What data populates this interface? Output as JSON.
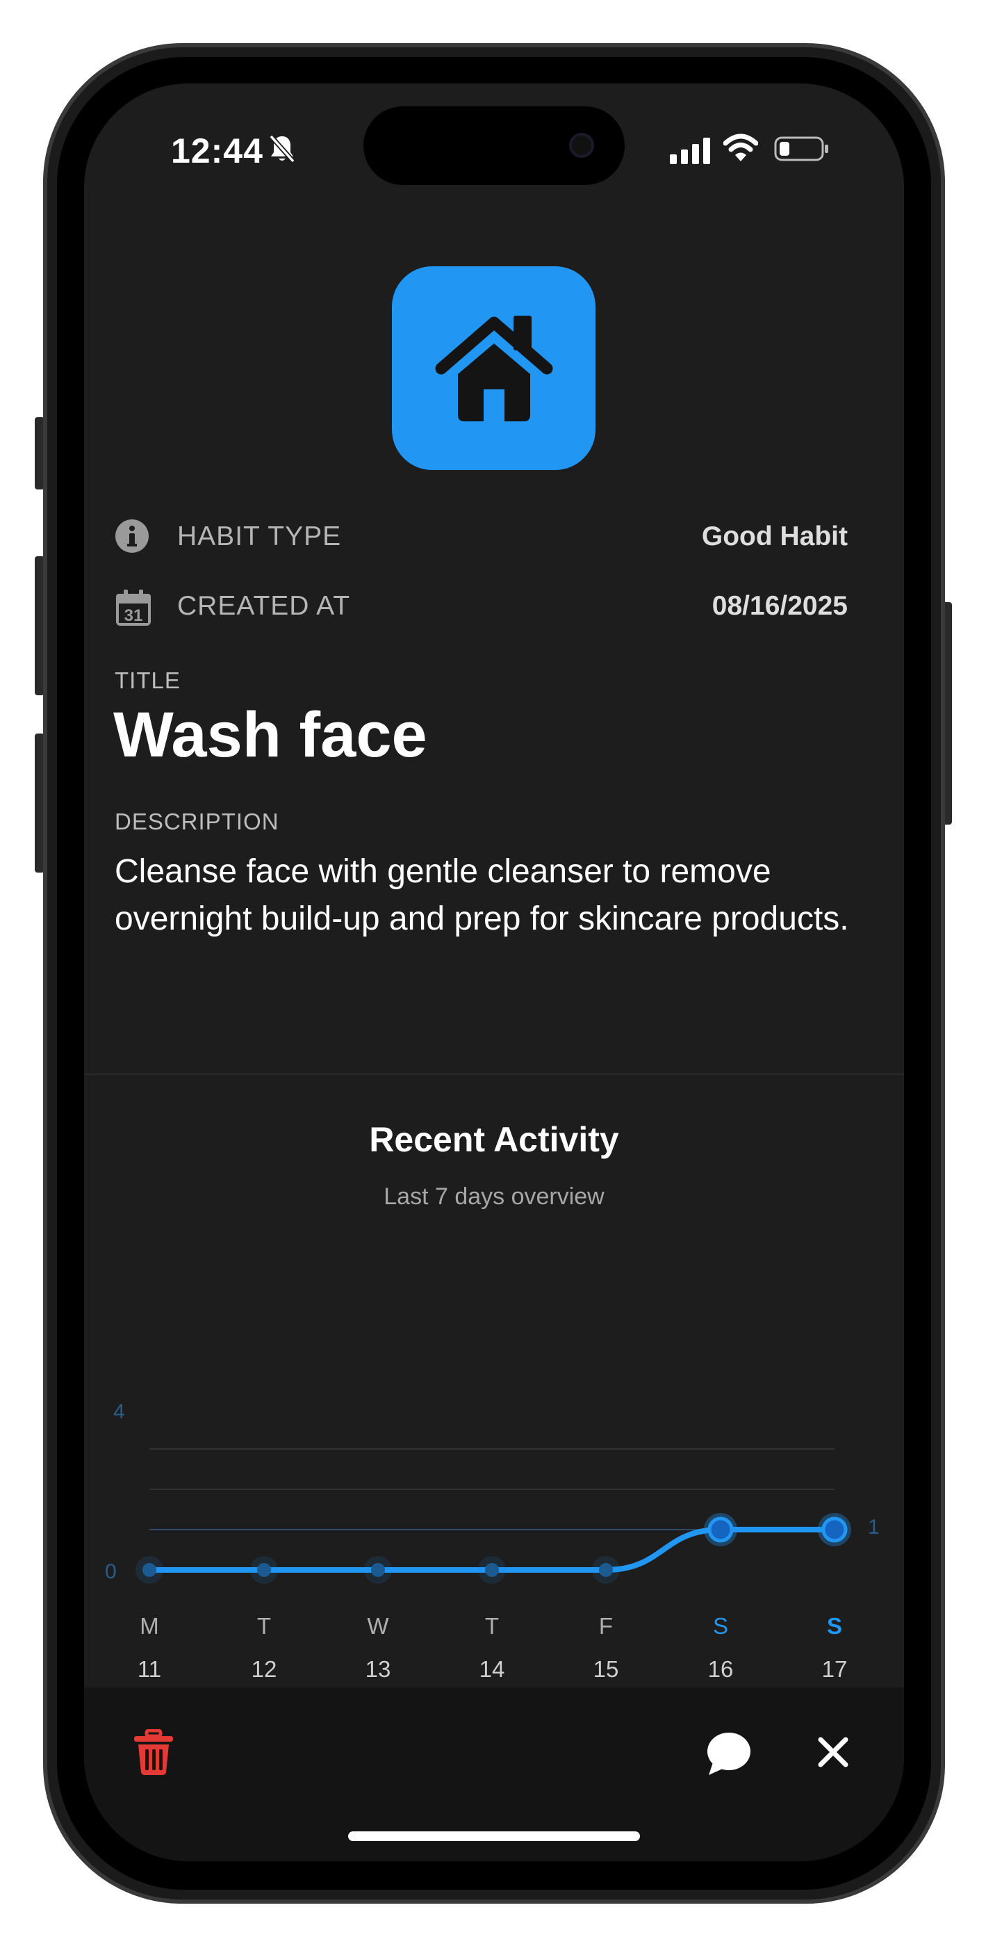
{
  "status_bar": {
    "time": "12:44",
    "icons": [
      "bell-slash-icon",
      "cellular-signal-icon",
      "wifi-icon",
      "battery-icon"
    ]
  },
  "header": {
    "icon": "house-icon",
    "icon_color": "#2196f3"
  },
  "meta": {
    "habit_type_label": "HABIT TYPE",
    "habit_type_value": "Good Habit",
    "created_at_label": "CREATED AT",
    "created_at_value": "08/16/2025",
    "calendar_day": "31"
  },
  "habit": {
    "title_label": "TITLE",
    "title": "Wash face",
    "description_label": "DESCRIPTION",
    "description": "Cleanse face with gentle cleanser to remove overnight build-up and prep for skincare products."
  },
  "activity": {
    "title": "Recent Activity",
    "subtitle": "Last 7 days overview"
  },
  "chart_data": {
    "type": "line",
    "title": "",
    "xlabel": "",
    "ylabel": "",
    "categories": [
      "M",
      "T",
      "W",
      "T",
      "F",
      "S",
      "S"
    ],
    "dates": [
      "11",
      "12",
      "13",
      "14",
      "15",
      "16",
      "17"
    ],
    "values": [
      0,
      0,
      0,
      0,
      0,
      1,
      1
    ],
    "ylim": [
      0,
      4
    ],
    "y_axis_labels": [
      "4",
      "0"
    ],
    "right_axis_label": "1",
    "highlighted_days": [
      5,
      6
    ],
    "active_day_index": 6,
    "line_color": "#2196f3",
    "grid": true
  },
  "toolbar": {
    "delete_icon": "trash-icon",
    "comment_icon": "chat-bubble-icon",
    "close_icon": "close-icon",
    "delete_color": "#e53935"
  }
}
